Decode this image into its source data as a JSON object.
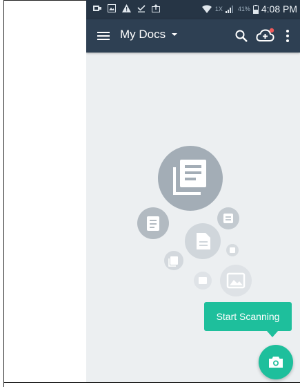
{
  "status_bar": {
    "network_label": "1X",
    "battery": "41%",
    "time": "4:08 PM"
  },
  "app_bar": {
    "title": "My Docs",
    "icons": [
      "menu-icon",
      "dropdown-caret-icon",
      "search-icon",
      "cloud-upload-icon",
      "more-vert-icon"
    ]
  },
  "empty_state": {
    "illustration": "documents-cluster"
  },
  "tooltip": {
    "label": "Start Scanning"
  },
  "fab": {
    "icon": "camera-icon"
  },
  "colors": {
    "status_bar": "#263545",
    "app_bar": "#2e4053",
    "background": "#eceff1",
    "accent": "#1ebf9c",
    "notification_dot": "#f05a5a"
  }
}
